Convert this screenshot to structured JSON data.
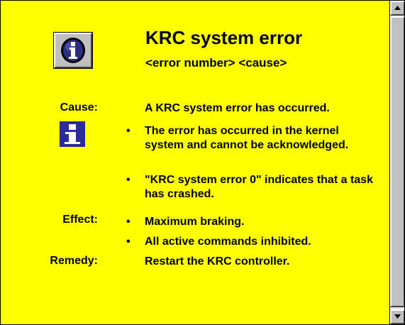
{
  "header": {
    "title": "KRC system error",
    "subtitle": "<error number> <cause>",
    "icon": "info-button-icon"
  },
  "sections": {
    "cause": {
      "label": "Cause:",
      "intro": "A KRC system error has occurred.",
      "icon": "info-icon",
      "bullets": [
        "The error has occurred in the kernel system and cannot be acknowledged.",
        "\"KRC system error 0\" indicates that a task has crashed."
      ]
    },
    "effect": {
      "label": "Effect:",
      "bullets": [
        "Maximum braking.",
        "All active commands inhibited."
      ]
    },
    "remedy": {
      "label": "Remedy:",
      "text": "Restart the KRC controller."
    }
  },
  "bullet_char": "•",
  "colors": {
    "background": "#ffff00",
    "info_square": "#2b2b9c",
    "scrollbar": "#c0c0c0"
  }
}
